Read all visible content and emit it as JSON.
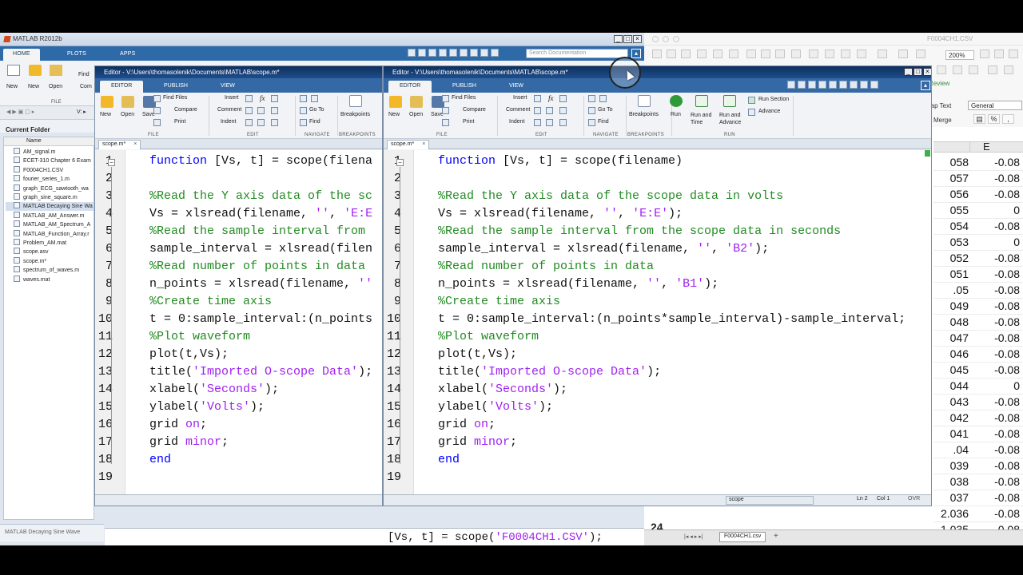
{
  "main": {
    "title": "MATLAB R2012b",
    "tabs": [
      "HOME",
      "PLOTS",
      "APPS"
    ],
    "search_placeholder": "Search Documentation",
    "ribbon": {
      "new_script": "New\nScript",
      "new": "New",
      "open": "Open",
      "find": "Find",
      "compare": "Com",
      "section": "FILE"
    },
    "current_folder_title": "Current Folder",
    "files_header": "Name",
    "files": [
      "AM_signal.m",
      "ECET-310 Chapter 6 Exam",
      "F0004CH1.CSV",
      "fourier_series_1.m",
      "graph_ECG_sawtooth_wa",
      "graph_sine_square.m",
      "MATLAB Decaying Sine Wa",
      "MATLAB_AM_Answer.m",
      "MATLAB_AM_Spectrum_A",
      "MATLAB_Function_Array.r",
      "Problem_AM.mat",
      "scope.asv",
      "scope.m*",
      "spectrum_of_waves.m",
      "waves.mat"
    ],
    "selected_file_index": 6,
    "detail_label": "MATLAB Decaying Sine Wave",
    "command_line": "[Vs, t] = scope('F0004CH1.CSV');"
  },
  "editor_left": {
    "title": "Editor - V:\\Users\\thomasolenik\\Documents\\MATLAB\\scope.m*",
    "tabs": [
      "EDITOR",
      "PUBLISH",
      "VIEW"
    ],
    "file_tab": "scope.m*",
    "sections": [
      "FILE",
      "EDIT",
      "NAVIGATE",
      "BREAKPOINTS"
    ],
    "lines": [
      "function [Vs, t] = scope(filena",
      "",
      "%Read the Y axis data of the sc",
      "Vs = xlsread(filename, '', 'E:E",
      "%Read the sample interval from ",
      "sample_interval = xlsread(filen",
      "%Read number of points in data ",
      "n_points = xlsread(filename, ''",
      "%Create time axis",
      "t = 0:sample_interval:(n_points",
      "%Plot waveform",
      "plot(t,Vs);",
      "title('Imported O-scope Data');",
      "xlabel('Seconds');",
      "ylabel('Volts');",
      "grid on;",
      "grid minor;",
      "end",
      ""
    ]
  },
  "editor_right": {
    "title": "Editor - V:\\Users\\thomasolenik\\Documents\\MATLAB\\scope.m*",
    "tabs": [
      "EDITOR",
      "PUBLISH",
      "VIEW"
    ],
    "file_tab": "scope.m*",
    "sections": [
      "FILE",
      "EDIT",
      "NAVIGATE",
      "BREAKPOINTS",
      "RUN"
    ],
    "run_section": "Run Section",
    "advance": "Advance",
    "run": "Run",
    "run_and_time": "Run and\nTime",
    "run_and_advance": "Run and\nAdvance",
    "status_name": "scope",
    "status_ln": "Ln 2",
    "status_col": "Col 1",
    "status_ovr": "OVR",
    "lines": [
      "function [Vs, t] = scope(filename)",
      "",
      "%Read the Y axis data of the scope data in volts",
      "Vs = xlsread(filename, '', 'E:E');",
      "%Read the sample interval from the scope data in seconds",
      "sample_interval = xlsread(filename, '', 'B2');",
      "%Read number of points in data",
      "n_points = xlsread(filename, '', 'B1');",
      "%Create time axis",
      "t = 0:sample_interval:(n_points*sample_interval)-sample_interval;",
      "%Plot waveform",
      "plot(t,Vs);",
      "title('Imported O-scope Data');",
      "xlabel('Seconds');",
      "ylabel('Volts');",
      "grid on;",
      "grid minor;",
      "end",
      ""
    ]
  },
  "ribbon_labels": {
    "new": "New",
    "open": "Open",
    "save": "Save",
    "find_files": "Find Files",
    "compare": "Compare",
    "print": "Print",
    "insert": "Insert",
    "comment": "Comment",
    "indent": "Indent",
    "go_to": "Go To",
    "find": "Find",
    "breakpoints": "Breakpoints",
    "fx": "fx"
  },
  "excel": {
    "filename": "F0004CH1.CSV",
    "zoom": "200%",
    "review": "Review",
    "wrap_text": "rap Text",
    "merge": "Merge",
    "number_format": "General",
    "column_header": "E",
    "col_d": [
      "058",
      "057",
      "056",
      "055",
      "054",
      "053",
      "052",
      "051",
      ".05",
      "049",
      "048",
      "047",
      "046",
      "045",
      "044",
      "043",
      "042",
      "041",
      ".04",
      "039",
      "038",
      "037",
      "2.036",
      "-1.035"
    ],
    "col_e": [
      "-0.08",
      "-0.08",
      "-0.08",
      "0",
      "-0.08",
      "0",
      "-0.08",
      "-0.08",
      "-0.08",
      "-0.08",
      "-0.08",
      "-0.08",
      "-0.08",
      "-0.08",
      "0",
      "-0.08",
      "-0.08",
      "-0.08",
      "-0.08",
      "-0.08",
      "-0.08",
      "-0.08",
      "-0.08",
      "-0.08"
    ],
    "row_number": "24",
    "sheet_tab": "F0004CH1.csv"
  }
}
